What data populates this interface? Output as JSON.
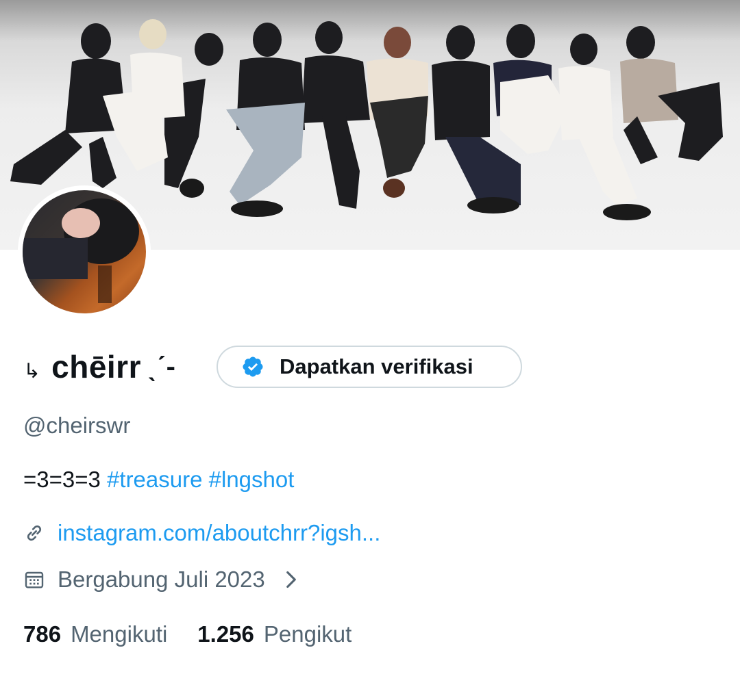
{
  "profile": {
    "name_prefix": "↳",
    "display_name": "chēirr",
    "name_suffix": "ˎˊ-",
    "handle": "@cheirswr",
    "verify_label": "Dapatkan verifikasi",
    "bio": {
      "text": "=3=3=3",
      "hashtags": [
        "#treasure",
        "#lngshot"
      ]
    },
    "link": "instagram.com/aboutchrr?igsh...",
    "joined": "Bergabung Juli 2023",
    "stats": {
      "following_count": "786",
      "following_label": "Mengikuti",
      "followers_count": "1.256",
      "followers_label": "Pengikut"
    }
  },
  "icons": {
    "verify": "verified-badge-icon",
    "link": "link-icon",
    "calendar": "calendar-icon",
    "chevron": "chevron-right-icon"
  },
  "colors": {
    "accent": "#1d9bf0",
    "secondary_text": "#536471",
    "primary_text": "#0f1419",
    "border": "#cfd9de"
  }
}
